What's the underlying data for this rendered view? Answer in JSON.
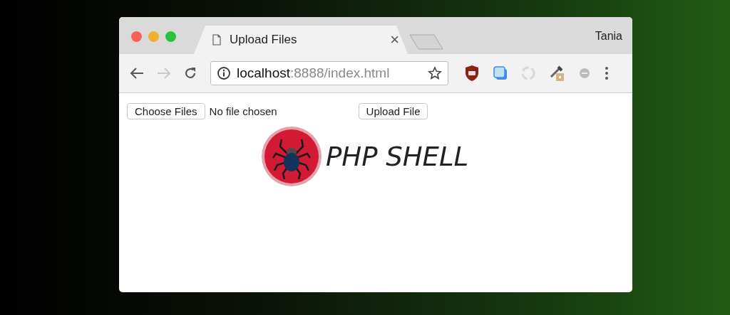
{
  "window": {
    "profile": "Tania"
  },
  "tabs": [
    {
      "title": "Upload Files",
      "close": "×",
      "selected": true
    },
    {
      "kind": "new-tab",
      "selected": false
    }
  ],
  "toolbar": {
    "back_disabled": false,
    "forward_disabled": true,
    "address": {
      "host": "localhost",
      "path": ":8888/index.html"
    }
  },
  "page": {
    "choose_button": "Choose Files",
    "file_status": "No file chosen",
    "upload_button": "Upload File",
    "logo_title": "PHP SHELL"
  }
}
